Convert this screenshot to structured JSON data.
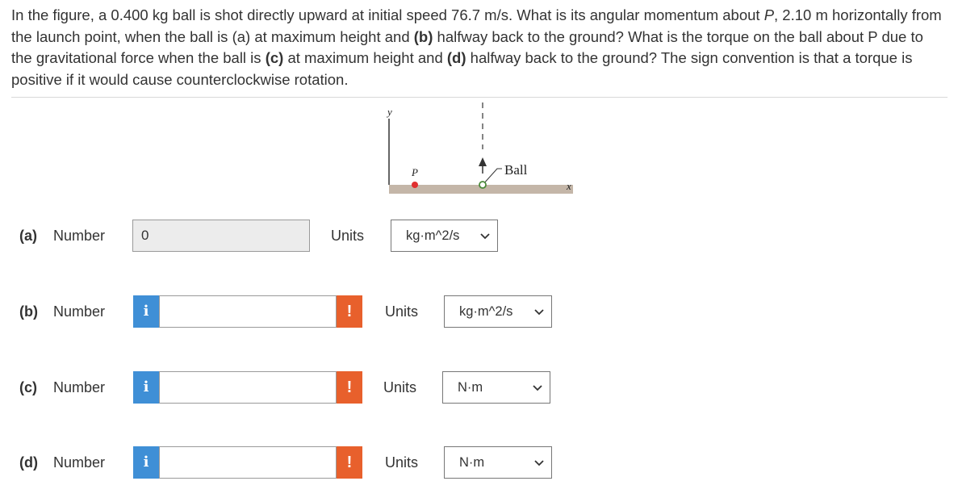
{
  "question": {
    "seg1": "In the figure, a 0.400 kg ball is shot directly upward at initial speed 76.7 m/s. What is its angular momentum about ",
    "p_var": "P",
    "seg2": ", 2.10 m horizontally from the launch point, when the ball is (a) at maximum height and ",
    "b_tag": "(b)",
    "seg3": " halfway back to the ground? What is the torque on the ball about P due to the gravitational force when the ball is ",
    "c_tag": "(c)",
    "seg4": " at maximum height and ",
    "d_tag": "(d)",
    "seg5": " halfway back to the ground? The sign convention is that a torque is positive if it would cause counterclockwise rotation."
  },
  "figure": {
    "y_label": "y",
    "x_label": "x",
    "p_label": "P",
    "ball_label": "Ball",
    "ground_color": "#c4b6a8",
    "p_dot_color": "#e03030",
    "launch_color": "#4a8a3a"
  },
  "rows": [
    {
      "part": "(a)",
      "number_label": "Number",
      "value": "0",
      "units_label": "Units",
      "unit": "kg·m^2/s"
    },
    {
      "part": "(b)",
      "number_label": "Number",
      "value": "",
      "units_label": "Units",
      "unit": "kg·m^2/s"
    },
    {
      "part": "(c)",
      "number_label": "Number",
      "value": "",
      "units_label": "Units",
      "unit": "N·m"
    },
    {
      "part": "(d)",
      "number_label": "Number",
      "value": "",
      "units_label": "Units",
      "unit": "N·m"
    }
  ],
  "icons": {
    "info": "i",
    "warning": "!"
  },
  "colors": {
    "info": "#3f8fd6",
    "warning": "#e8602c"
  }
}
